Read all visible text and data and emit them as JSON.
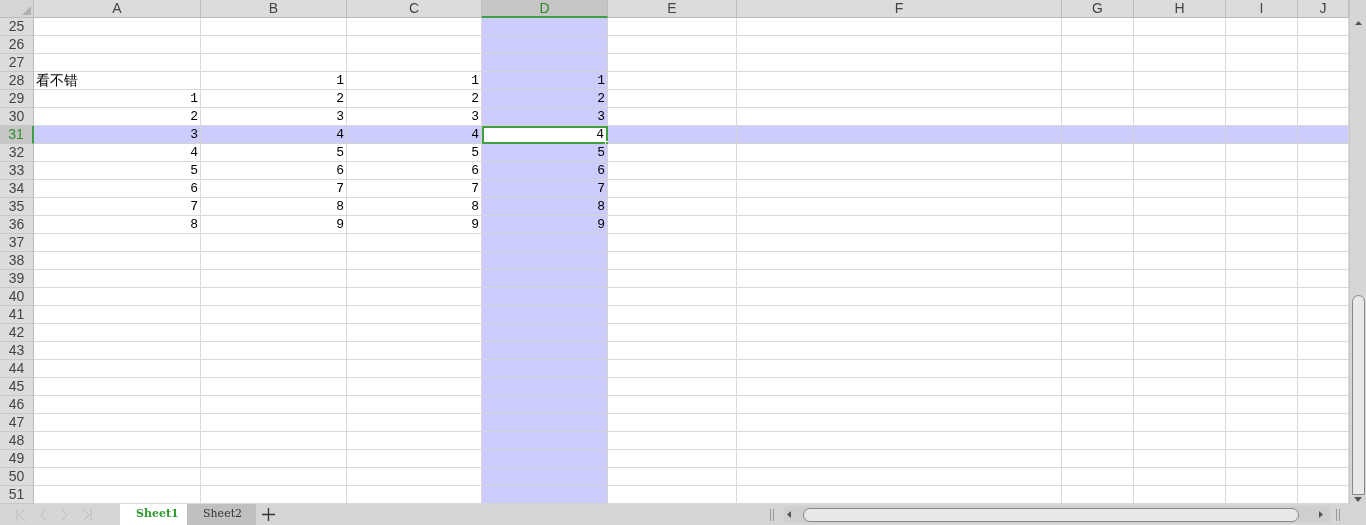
{
  "columns": [
    {
      "label": "A",
      "selected": false
    },
    {
      "label": "B",
      "selected": false
    },
    {
      "label": "C",
      "selected": false
    },
    {
      "label": "D",
      "selected": true
    },
    {
      "label": "E",
      "selected": false
    },
    {
      "label": "F",
      "selected": false
    },
    {
      "label": "G",
      "selected": false
    },
    {
      "label": "H",
      "selected": false
    },
    {
      "label": "I",
      "selected": false
    },
    {
      "label": "J",
      "selected": false
    }
  ],
  "rows": [
    {
      "number": "25",
      "selected": false,
      "cells": []
    },
    {
      "number": "26",
      "selected": false,
      "cells": []
    },
    {
      "number": "27",
      "selected": false,
      "cells": []
    },
    {
      "number": "28",
      "selected": false,
      "cells": [
        {
          "value": "看不错",
          "kind": "text"
        },
        {
          "value": "1",
          "kind": "number"
        },
        {
          "value": "1",
          "kind": "number"
        },
        {
          "value": "1",
          "kind": "number"
        }
      ]
    },
    {
      "number": "29",
      "selected": false,
      "cells": [
        {
          "value": "1",
          "kind": "number"
        },
        {
          "value": "2",
          "kind": "number"
        },
        {
          "value": "2",
          "kind": "number"
        },
        {
          "value": "2",
          "kind": "number"
        }
      ]
    },
    {
      "number": "30",
      "selected": false,
      "cells": [
        {
          "value": "2",
          "kind": "number"
        },
        {
          "value": "3",
          "kind": "number"
        },
        {
          "value": "3",
          "kind": "number"
        },
        {
          "value": "3",
          "kind": "number"
        }
      ]
    },
    {
      "number": "31",
      "selected": true,
      "cells": [
        {
          "value": "3",
          "kind": "number"
        },
        {
          "value": "4",
          "kind": "number"
        },
        {
          "value": "4",
          "kind": "number"
        },
        {
          "value": "4",
          "kind": "number"
        }
      ]
    },
    {
      "number": "32",
      "selected": false,
      "cells": [
        {
          "value": "4",
          "kind": "number"
        },
        {
          "value": "5",
          "kind": "number"
        },
        {
          "value": "5",
          "kind": "number"
        },
        {
          "value": "5",
          "kind": "number"
        }
      ]
    },
    {
      "number": "33",
      "selected": false,
      "cells": [
        {
          "value": "5",
          "kind": "number"
        },
        {
          "value": "6",
          "kind": "number"
        },
        {
          "value": "6",
          "kind": "number"
        },
        {
          "value": "6",
          "kind": "number"
        }
      ]
    },
    {
      "number": "34",
      "selected": false,
      "cells": [
        {
          "value": "6",
          "kind": "number"
        },
        {
          "value": "7",
          "kind": "number"
        },
        {
          "value": "7",
          "kind": "number"
        },
        {
          "value": "7",
          "kind": "number"
        }
      ]
    },
    {
      "number": "35",
      "selected": false,
      "cells": [
        {
          "value": "7",
          "kind": "number"
        },
        {
          "value": "8",
          "kind": "number"
        },
        {
          "value": "8",
          "kind": "number"
        },
        {
          "value": "8",
          "kind": "number"
        }
      ]
    },
    {
      "number": "36",
      "selected": false,
      "cells": [
        {
          "value": "8",
          "kind": "number"
        },
        {
          "value": "9",
          "kind": "number"
        },
        {
          "value": "9",
          "kind": "number"
        },
        {
          "value": "9",
          "kind": "number"
        }
      ]
    },
    {
      "number": "37",
      "selected": false,
      "cells": []
    },
    {
      "number": "38",
      "selected": false,
      "cells": []
    },
    {
      "number": "39",
      "selected": false,
      "cells": []
    },
    {
      "number": "40",
      "selected": false,
      "cells": []
    },
    {
      "number": "41",
      "selected": false,
      "cells": []
    },
    {
      "number": "42",
      "selected": false,
      "cells": []
    },
    {
      "number": "43",
      "selected": false,
      "cells": []
    },
    {
      "number": "44",
      "selected": false,
      "cells": []
    },
    {
      "number": "45",
      "selected": false,
      "cells": []
    },
    {
      "number": "46",
      "selected": false,
      "cells": []
    },
    {
      "number": "47",
      "selected": false,
      "cells": []
    },
    {
      "number": "48",
      "selected": false,
      "cells": []
    },
    {
      "number": "49",
      "selected": false,
      "cells": []
    },
    {
      "number": "50",
      "selected": false,
      "cells": []
    },
    {
      "number": "51",
      "selected": false,
      "cells": []
    }
  ],
  "sheet_tabs": [
    {
      "label": "Sheet1",
      "selected": true
    },
    {
      "label": "Sheet2",
      "selected": false
    }
  ]
}
